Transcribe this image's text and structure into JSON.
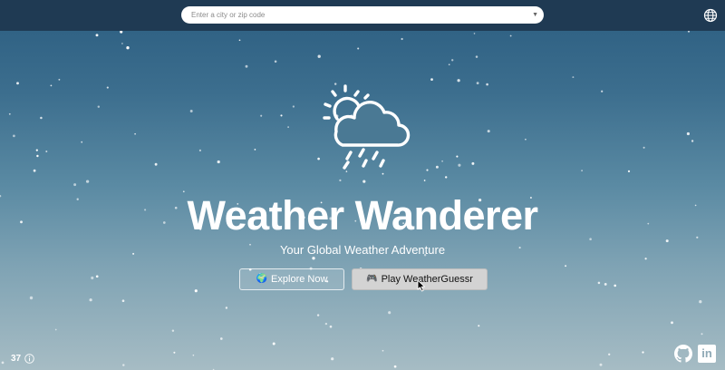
{
  "header": {
    "search": {
      "placeholder": "Enter a city or zip code",
      "caret_icon": "caret-down-icon"
    },
    "language_icon": "globe-icon"
  },
  "hero": {
    "icon": "sun-cloud-rain-icon",
    "title": "Weather Wanderer",
    "subtitle": "Your Global Weather Adventure",
    "buttons": {
      "explore": {
        "emoji": "🌍",
        "label": "Explore Now"
      },
      "play": {
        "emoji": "🎮",
        "label": "Play WeatherGuessr"
      }
    }
  },
  "footer": {
    "count": "37",
    "info_icon": "info-icon",
    "links": [
      "github-icon",
      "linkedin-icon"
    ],
    "linkedin_glyph": "in"
  },
  "colors": {
    "topbar": "#1f3a53",
    "gradient_top": "#2b5d80",
    "gradient_bottom": "#a6bcc4",
    "play_button": "#d3d3d3"
  }
}
